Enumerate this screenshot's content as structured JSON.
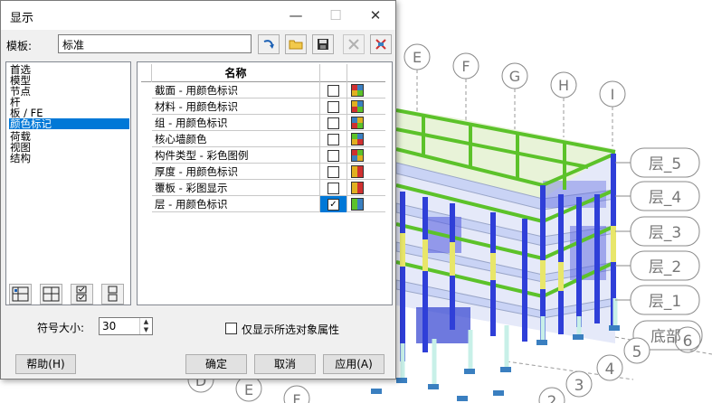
{
  "window": {
    "title": "显示",
    "minimize": "—",
    "maximize": "☐",
    "close": "✕"
  },
  "template": {
    "label": "模板:",
    "value": "标准"
  },
  "tree": {
    "items": [
      "首选",
      "模型",
      "节点",
      "杆",
      "板 / FE",
      "颜色标记",
      "荷载",
      "视图",
      "结构"
    ],
    "selected_index": 5
  },
  "grid": {
    "header_name": "名称",
    "rows": [
      {
        "name": "截面 - 用颜色标识",
        "checked": false,
        "icon": "section-color-icon"
      },
      {
        "name": "材料 - 用颜色标识",
        "checked": false,
        "icon": "material-color-icon"
      },
      {
        "name": "组 - 用颜色标识",
        "checked": false,
        "icon": "group-color-icon"
      },
      {
        "name": "核心墙颜色",
        "checked": false,
        "icon": "core-wall-color-icon"
      },
      {
        "name": " 构件类型 - 彩色图例",
        "checked": false,
        "icon": "member-type-color-icon"
      },
      {
        "name": "厚度 - 用颜色标识",
        "checked": false,
        "icon": "thickness-color-icon"
      },
      {
        "name": "覆板 - 彩图显示",
        "checked": false,
        "icon": "cladding-color-icon"
      },
      {
        "name": "层 - 用颜色标识",
        "checked": true,
        "icon": "story-color-icon"
      }
    ]
  },
  "symbol_size": {
    "label": "符号大小:",
    "value": "30"
  },
  "only_selected": {
    "label": "仅显示所选对象属性",
    "checked": false
  },
  "buttons": {
    "help": "帮助(H)",
    "ok": "确定",
    "cancel": "取消",
    "apply": "应用(A)"
  },
  "model_view": {
    "axis_labels": [
      "E",
      "F",
      "G",
      "H",
      "I"
    ],
    "story_labels": [
      "层_5",
      "层_4",
      "层_3",
      "层_2",
      "层_1",
      "底部"
    ],
    "bottom_axis_numbers": [
      "6",
      "5",
      "4",
      "3",
      "2"
    ],
    "bottom_axis_letters": [
      "D",
      "E",
      "F"
    ],
    "colors": {
      "beam": "#6fd13a",
      "column_blue": "#2f3fd8",
      "column_yellow": "#e8e66a",
      "slab": "#c9d3f5",
      "support": "#3a7fc0"
    }
  }
}
